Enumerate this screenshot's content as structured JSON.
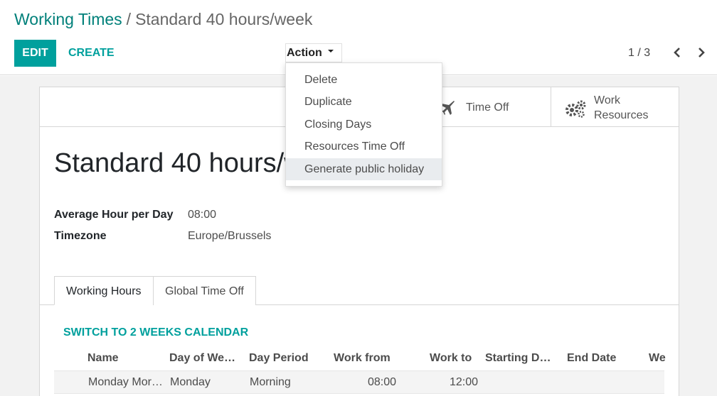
{
  "breadcrumb": {
    "parent": "Working Times",
    "separator": "/",
    "current": "Standard 40 hours/week"
  },
  "toolbar": {
    "edit_label": "EDIT",
    "create_label": "CREATE",
    "action_label": "Action",
    "pager": "1 / 3"
  },
  "action_menu": {
    "items": [
      "Delete",
      "Duplicate",
      "Closing Days",
      "Resources Time Off",
      "Generate public holiday"
    ],
    "highlighted": "Generate public holiday"
  },
  "smart_buttons": {
    "time_off": "Time Off",
    "work_resources_line1": "Work",
    "work_resources_line2": "Resources"
  },
  "record": {
    "title": "Standard 40 hours/week",
    "fields": [
      {
        "label": "Average Hour per Day",
        "value": "08:00"
      },
      {
        "label": "Timezone",
        "value": "Europe/Brussels"
      }
    ]
  },
  "tabs": [
    "Working Hours",
    "Global Time Off"
  ],
  "active_tab": "Working Hours",
  "switch_link": "SWITCH TO 2 WEEKS CALENDAR",
  "table": {
    "headers": [
      "Name",
      "Day of We…",
      "Day Period",
      "Work from",
      "Work to",
      "Starting D…",
      "End Date",
      "We"
    ],
    "rows": [
      [
        "Monday Mor…",
        "Monday",
        "Morning",
        "08:00",
        "12:00",
        "",
        "",
        ""
      ]
    ]
  },
  "colors": {
    "primary": "#00a09d",
    "link": "#00807a",
    "menu_hover": "#e9ecef"
  }
}
